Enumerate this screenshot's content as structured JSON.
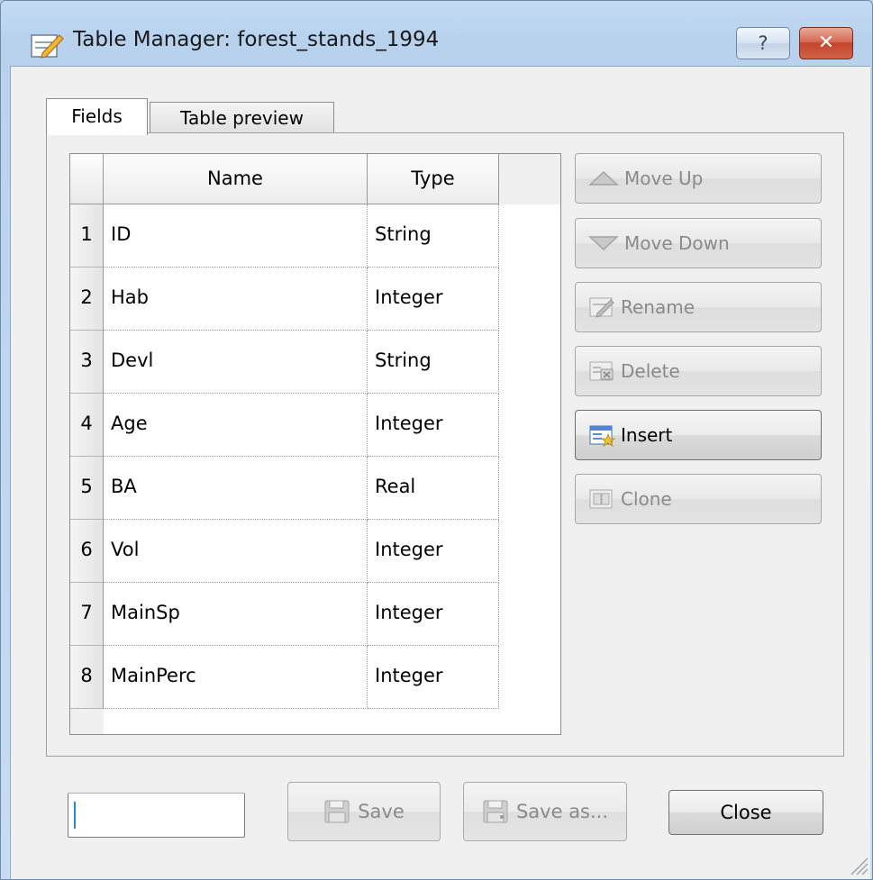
{
  "window": {
    "title": "Table Manager: forest_stands_1994",
    "help_label": "?",
    "close_label": "✕"
  },
  "tabs": [
    {
      "label": "Fields",
      "active": true
    },
    {
      "label": "Table preview",
      "active": false
    }
  ],
  "table": {
    "headers": {
      "name": "Name",
      "type": "Type"
    },
    "rows": [
      {
        "num": "1",
        "name": "ID",
        "type": "String"
      },
      {
        "num": "2",
        "name": "Hab",
        "type": "Integer"
      },
      {
        "num": "3",
        "name": "Devl",
        "type": "String"
      },
      {
        "num": "4",
        "name": "Age",
        "type": "Integer"
      },
      {
        "num": "5",
        "name": "BA",
        "type": "Real"
      },
      {
        "num": "6",
        "name": "Vol",
        "type": "Integer"
      },
      {
        "num": "7",
        "name": "MainSp",
        "type": "Integer"
      },
      {
        "num": "8",
        "name": "MainPerc",
        "type": "Integer"
      }
    ]
  },
  "side_buttons": {
    "move_up": {
      "label": "Move Up",
      "icon": "triangle-up-icon",
      "enabled": false
    },
    "move_down": {
      "label": "Move Down",
      "icon": "triangle-down-icon",
      "enabled": false
    },
    "rename": {
      "label": "Rename",
      "icon": "rename-icon",
      "enabled": false
    },
    "delete": {
      "label": "Delete",
      "icon": "delete-field-icon",
      "enabled": false
    },
    "insert": {
      "label": "Insert",
      "icon": "insert-field-icon",
      "enabled": true
    },
    "clone": {
      "label": "Clone",
      "icon": "clone-field-icon",
      "enabled": false
    }
  },
  "bottom": {
    "input_value": "",
    "save_label": "Save",
    "save_as_label": "Save as...",
    "close_label": "Close"
  },
  "colors": {
    "frame": "#b9d1ea",
    "close_button": "#c3442b",
    "caret": "#2a8ad4"
  }
}
